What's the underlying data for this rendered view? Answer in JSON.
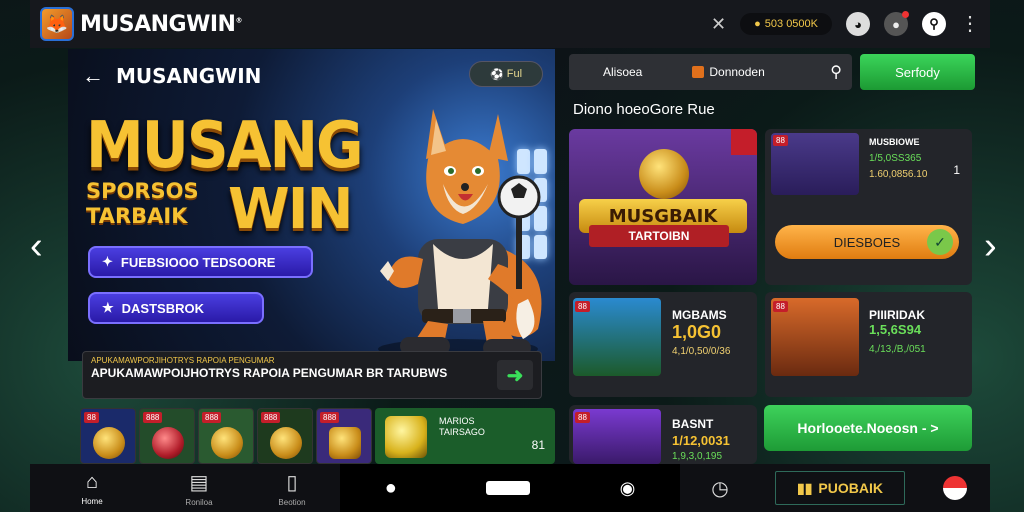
{
  "header": {
    "brand": "MUSANGWIN",
    "brand_mark": "®",
    "balance": "503 0500K"
  },
  "hero": {
    "title": "MUSANGWIN",
    "pill": "Ful",
    "headline_top": "MUSANG",
    "headline_side_1": "SPORSOS",
    "headline_side_2": "TARBAIK",
    "headline_bottom": "WIN",
    "button1_label": "FUEBSIOOO TEDSOORE",
    "button2_label": "DASTSBROK"
  },
  "notice": {
    "label": "APUKAMAWPORJIHOTRYS RAPOIA PENGUMAR",
    "text": "APUKAMAWPOIJHOTRYS RAPOIA PENGUMAR BR TARUBWS"
  },
  "mini_strip": {
    "tags": [
      "88",
      "888",
      "888",
      "888",
      "888"
    ],
    "wide_title": "MARIOS\nTAIRSAGO",
    "wide_num": "81"
  },
  "search": {
    "option1": "Alisoea",
    "option2": "Donnoden"
  },
  "search_button": "Serfody",
  "section_title": "Diono hoeoGore Rue",
  "featured": {
    "banner_title": "MUSGBAIK",
    "banner_ribbon": "TARTOIBN"
  },
  "side_card": {
    "tag": "88",
    "name": "MUSBIOWE",
    "num": "1/5,0SS365",
    "sub": "1.60,0856.10",
    "count": "1",
    "button": "DIESBOES"
  },
  "cards": [
    {
      "tag": "88",
      "name": "MGBAMS",
      "num": "1,0G0",
      "sub": "4,1/0,50/0/36"
    },
    {
      "tag": "88",
      "name": "PIIIRIDAK",
      "num": "1,5,6S94",
      "sub": "4,/13,/B,/051"
    },
    {
      "tag": "88",
      "name": "BASNT",
      "num": "1/12,0031",
      "sub": "1,9,3,0,195"
    }
  ],
  "promo_button": "Horlooete.Noeosn - >",
  "tabbar": {
    "home": "Home",
    "tab2": "Roniloa",
    "tab3": "Beotion",
    "vip_label": "PUOBAIK"
  }
}
